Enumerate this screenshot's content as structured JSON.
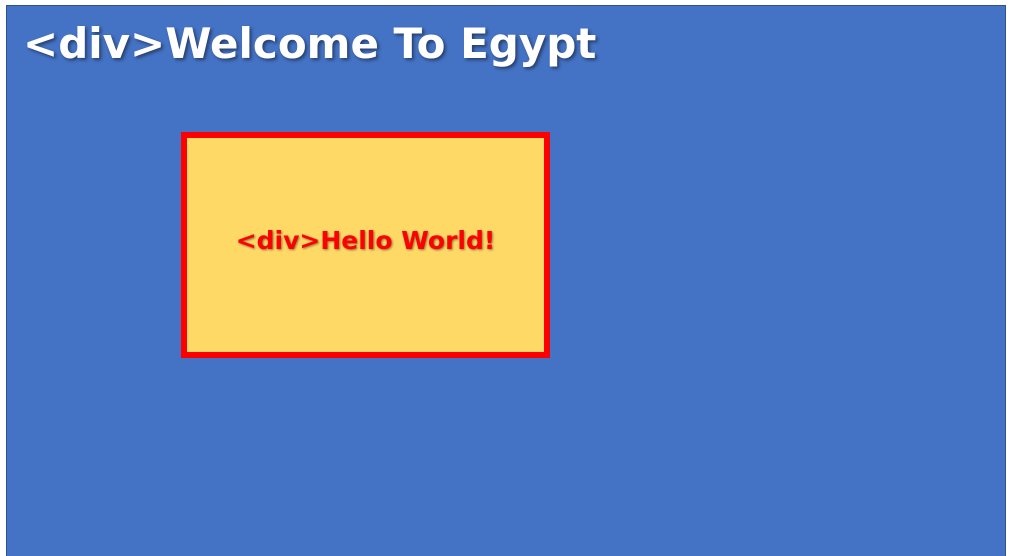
{
  "outer": {
    "label": "<div>Welcome To Egypt",
    "fill_color": "#4472c4",
    "text_color": "#ffffff"
  },
  "inner": {
    "label": "<div>Hello World!",
    "fill_color": "#ffd966",
    "border_color": "#ff0000",
    "text_color": "#ff0000"
  }
}
